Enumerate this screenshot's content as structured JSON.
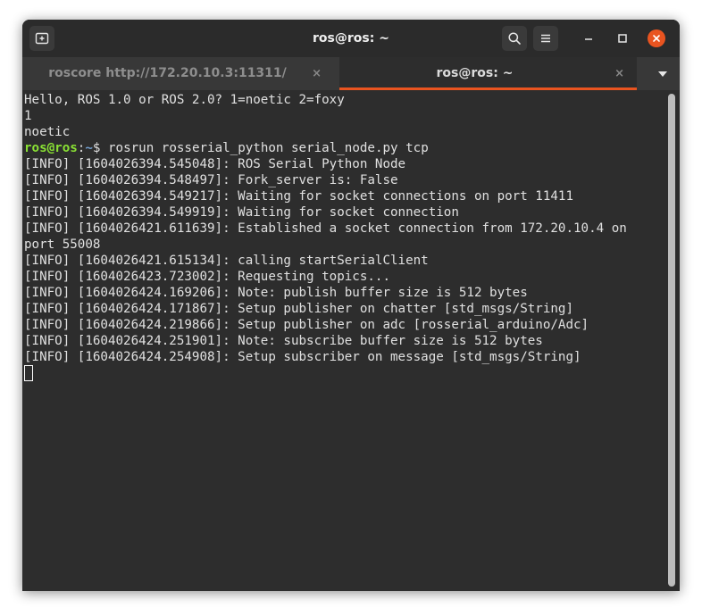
{
  "window": {
    "title": "ros@ros: ~"
  },
  "tabs": [
    {
      "label": "roscore http://172.20.10.3:11311/",
      "close": "×",
      "active": false
    },
    {
      "label": "ros@ros: ~",
      "close": "×",
      "active": true
    }
  ],
  "colors": {
    "accent": "#e95420",
    "close_button": "#e95420",
    "prompt_user": "#8ae234",
    "prompt_path": "#729fcf",
    "terminal_bg": "#2d2d2d"
  },
  "terminal": {
    "lines_before": "Hello, ROS 1.0 or ROS 2.0? 1=noetic 2=foxy\n1\nnoetic",
    "prompt_user": "ros@ros",
    "prompt_sep": ":",
    "prompt_path": "~",
    "prompt_symbol": "$ ",
    "command": "rosrun rosserial_python serial_node.py tcp",
    "output": "[INFO] [1604026394.545048]: ROS Serial Python Node\n[INFO] [1604026394.548497]: Fork_server is: False\n[INFO] [1604026394.549217]: Waiting for socket connections on port 11411\n[INFO] [1604026394.549919]: Waiting for socket connection\n[INFO] [1604026421.611639]: Established a socket connection from 172.20.10.4 on\nport 55008\n[INFO] [1604026421.615134]: calling startSerialClient\n[INFO] [1604026423.723002]: Requesting topics...\n[INFO] [1604026424.169206]: Note: publish buffer size is 512 bytes\n[INFO] [1604026424.171867]: Setup publisher on chatter [std_msgs/String]\n[INFO] [1604026424.219866]: Setup publisher on adc [rosserial_arduino/Adc]\n[INFO] [1604026424.251901]: Note: subscribe buffer size is 512 bytes\n[INFO] [1604026424.254908]: Setup subscriber on message [std_msgs/String]"
  },
  "icons": {
    "new_tab": "new-tab-icon",
    "search": "search-icon",
    "menu": "hamburger-menu-icon",
    "minimize": "minimize-icon",
    "maximize": "maximize-icon",
    "close": "close-icon",
    "tab_dropdown": "chevron-down-icon"
  }
}
